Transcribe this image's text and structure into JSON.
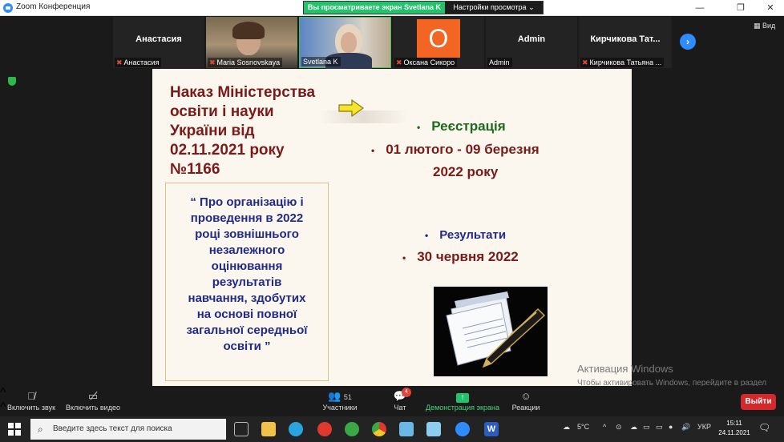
{
  "window": {
    "title": "Zoom Конференция",
    "share_banner": "Вы просматриваете экран Svetlana K",
    "view_options": "Настройки просмотра",
    "view_button": "Вид"
  },
  "gallery": [
    {
      "center_name": "Анастасия",
      "label": "Анастасия",
      "muted": true
    },
    {
      "center_name": "",
      "label": "Maria Sosnovskaya",
      "muted": true
    },
    {
      "center_name": "",
      "label": "Svetlana K",
      "muted": false
    },
    {
      "center_name": "",
      "initial": "О",
      "label": "Оксана Сикоро",
      "muted": true
    },
    {
      "center_name": "Admin",
      "label": "Admin",
      "muted": false
    },
    {
      "center_name": "Кирчикова Тат...",
      "label": "Кирчикова Татьяна ...",
      "muted": true
    }
  ],
  "slide": {
    "decree_lines": [
      "Наказ Міністерства",
      "освіти і науки",
      "України від",
      "02.11.2021 року",
      "№1166"
    ],
    "quote_lines": [
      "“ Про організацію і",
      "проведення в 2022",
      "році зовнішнього",
      "незалежного",
      "оцінювання",
      "результатів",
      "навчання, здобутих",
      "на основі повної",
      "загальної середньої",
      "освіти ”"
    ],
    "registration": "Реєстрація",
    "reg_dates_1": "01 лютого -  09 березня",
    "reg_dates_2": "2022 року",
    "results": "Результати",
    "results_date": "30 червня 2022"
  },
  "watermark": {
    "line1": "Активация Windows",
    "line2": "Чтобы активировать Windows, перейдите в раздел \"Параметры\"."
  },
  "toolbar": {
    "audio": "Включить звук",
    "video": "Включить видео",
    "participants": "Участники",
    "participants_count": "51",
    "chat": "Чат",
    "chat_badge": "4",
    "share": "Демонстрация экрана",
    "reactions": "Реакции",
    "leave": "Выйти"
  },
  "taskbar": {
    "search_placeholder": "Введите здесь текст для поиска",
    "temperature": "5°C",
    "language": "УКР",
    "time": "15:11",
    "date": "24.11.2021"
  },
  "colors": {
    "zoom_blue": "#2d8cff",
    "share_green": "#22c36b",
    "leave_red": "#d3282c",
    "decree_red": "#7a1a1a",
    "reg_green": "#1c6a1c",
    "quote_blue": "#1f2a8a"
  }
}
